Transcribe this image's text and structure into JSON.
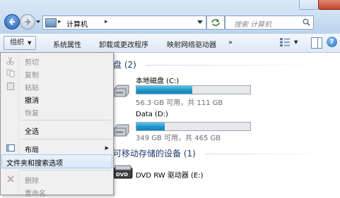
{
  "window": {
    "address": {
      "path_segment": "计算机",
      "separator": "▸"
    },
    "search": {
      "placeholder": "搜索 计算机"
    }
  },
  "toolbar": {
    "organize_label": "组织",
    "items": [
      {
        "label": "系统属性"
      },
      {
        "label": "卸载或更改程序"
      },
      {
        "label": "映射网络驱动器"
      },
      {
        "label": "»"
      }
    ],
    "help_label": "?"
  },
  "menu": {
    "items": [
      {
        "label": "剪切",
        "enabled": false,
        "icon": "scissors-icon"
      },
      {
        "label": "复制",
        "enabled": false,
        "icon": "copy-icon"
      },
      {
        "label": "粘贴",
        "enabled": false,
        "icon": "paste-icon"
      },
      {
        "label": "撤消",
        "enabled": true
      },
      {
        "label": "恢复",
        "enabled": false
      },
      {
        "label": "全选",
        "enabled": true
      },
      {
        "label": "布局",
        "enabled": true,
        "icon": "layout-icon",
        "submenu": true
      },
      {
        "label": "文件夹和搜索选项",
        "enabled": true,
        "highlighted": true
      },
      {
        "label": "删除",
        "enabled": false,
        "icon": "delete-icon"
      },
      {
        "label": "重命名",
        "enabled": false
      }
    ]
  },
  "content": {
    "hard_disks": {
      "header": "盘 (2)"
    },
    "drives": [
      {
        "name": "本地磁盘 (C:)",
        "status": "56.3 GB 可用，共 111 GB",
        "used_fraction": 0.49
      },
      {
        "name": "Data (D:)",
        "status": "349 GB 可用，共 465 GB",
        "used_fraction": 0.25
      }
    ],
    "removable": {
      "header": "可移动存储的设备 (1)"
    },
    "dvd": {
      "name": "DVD RW 驱动器 (E:)"
    }
  },
  "colors": {
    "accent": "#1c93c8",
    "header_text": "#1e3a6e",
    "menu_highlight": "#d9e7f7"
  }
}
